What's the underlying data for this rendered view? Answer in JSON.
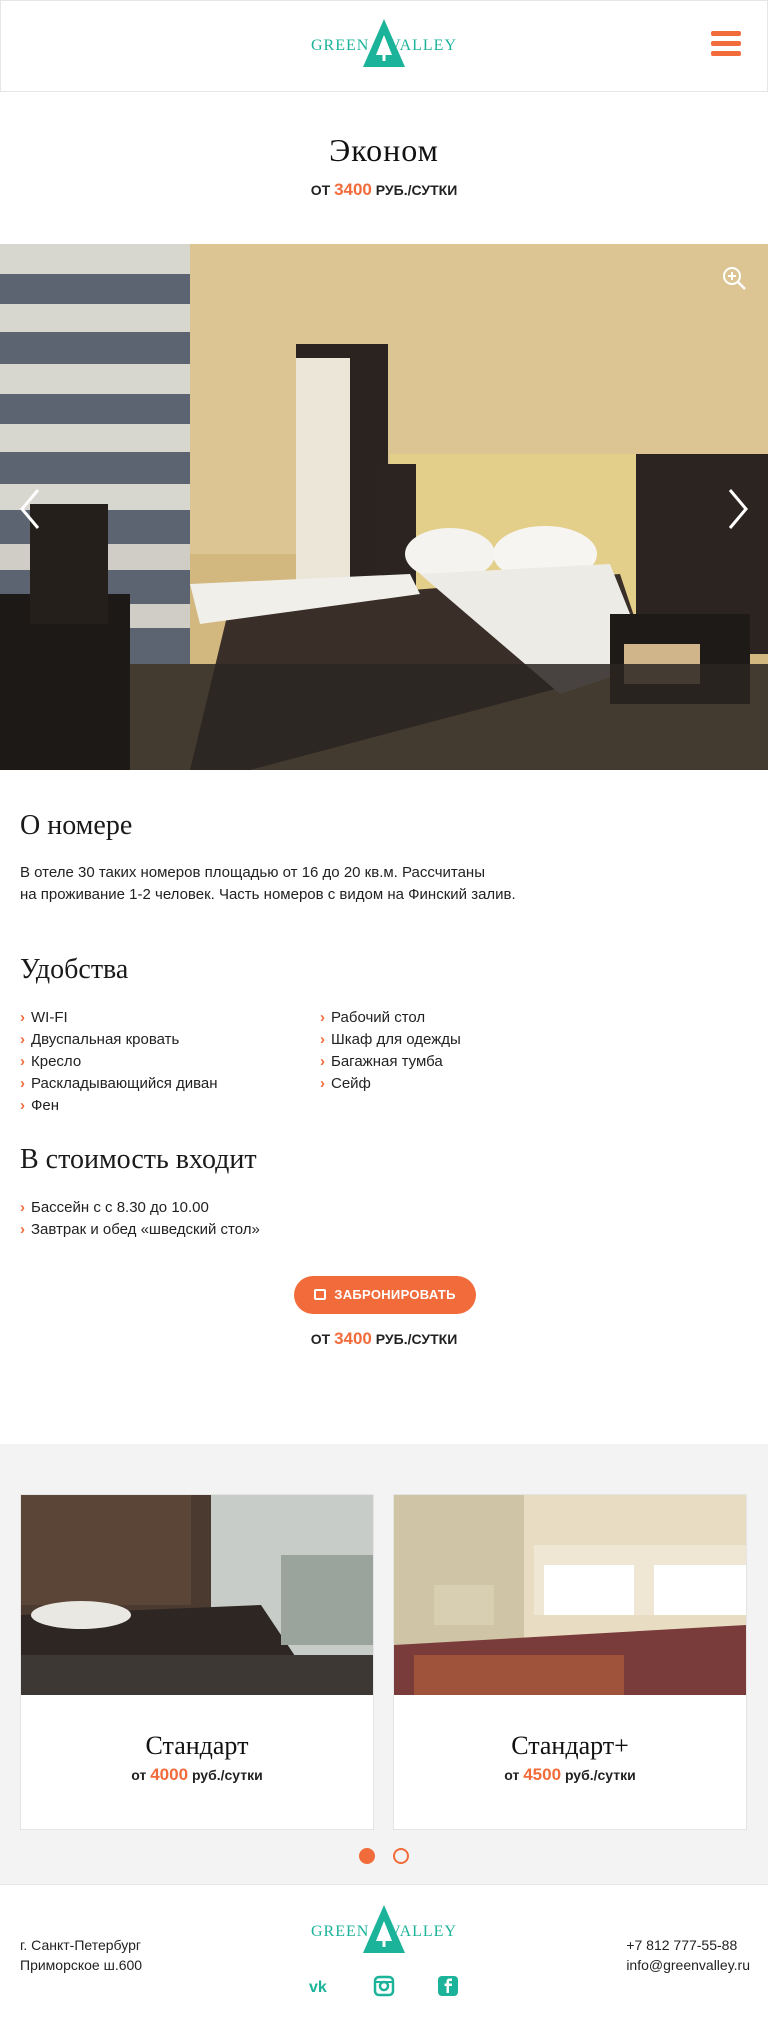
{
  "brand": {
    "left": "GREEN",
    "right": "VALLEY"
  },
  "room": {
    "title": "Эконом",
    "price_prefix": "от",
    "price": "3400",
    "price_unit": "руб./сутки"
  },
  "about": {
    "heading": "О номере",
    "line1": "В отеле 30 таких номеров площадью от 16 до 20 кв.м. Рассчитаны",
    "line2": "на проживание 1-2 человек. Часть номеров с видом на Финский залив."
  },
  "amenities": {
    "heading": "Удобства",
    "col1": [
      "WI-FI",
      "Двуспальная кровать",
      "Кресло",
      "Раскладывающийся диван",
      "Фен"
    ],
    "col2": [
      "Рабочий стол",
      "Шкаф для одежды",
      "Багажная тумба",
      "Сейф"
    ]
  },
  "included": {
    "heading": "В стоимость входит",
    "items": [
      "Бассейн с с 8.30 до 10.00",
      "Завтрак и обед «шведский стол»"
    ]
  },
  "booking": {
    "button_label": "ЗАБРОНИРОВАТЬ",
    "price_prefix": "от",
    "price": "3400",
    "price_unit": "руб./сутки"
  },
  "other_rooms": [
    {
      "name": "Стандарт",
      "price_prefix": "от",
      "price": "4000",
      "price_unit": "руб./сутки"
    },
    {
      "name": "Стандарт+",
      "price_prefix": "от",
      "price": "4500",
      "price_unit": "руб./сутки"
    }
  ],
  "carousel": {
    "active_page": 1,
    "pages": 2
  },
  "footer": {
    "city": "г. Санкт-Петербург",
    "street": "Приморское ш.600",
    "phone": "+7 812 777-55-88",
    "email": "info@greenvalley.ru"
  },
  "icons": {
    "menu": "hamburger-icon",
    "zoom": "zoom-in-icon",
    "prev": "chevron-left-icon",
    "next": "chevron-right-icon",
    "calendar": "calendar-icon",
    "social": [
      "vk-icon",
      "instagram-icon",
      "facebook-icon"
    ]
  },
  "colors": {
    "accent": "#f26b3a",
    "brand": "#1bb39a",
    "muted_bg": "#f3f3f3"
  }
}
